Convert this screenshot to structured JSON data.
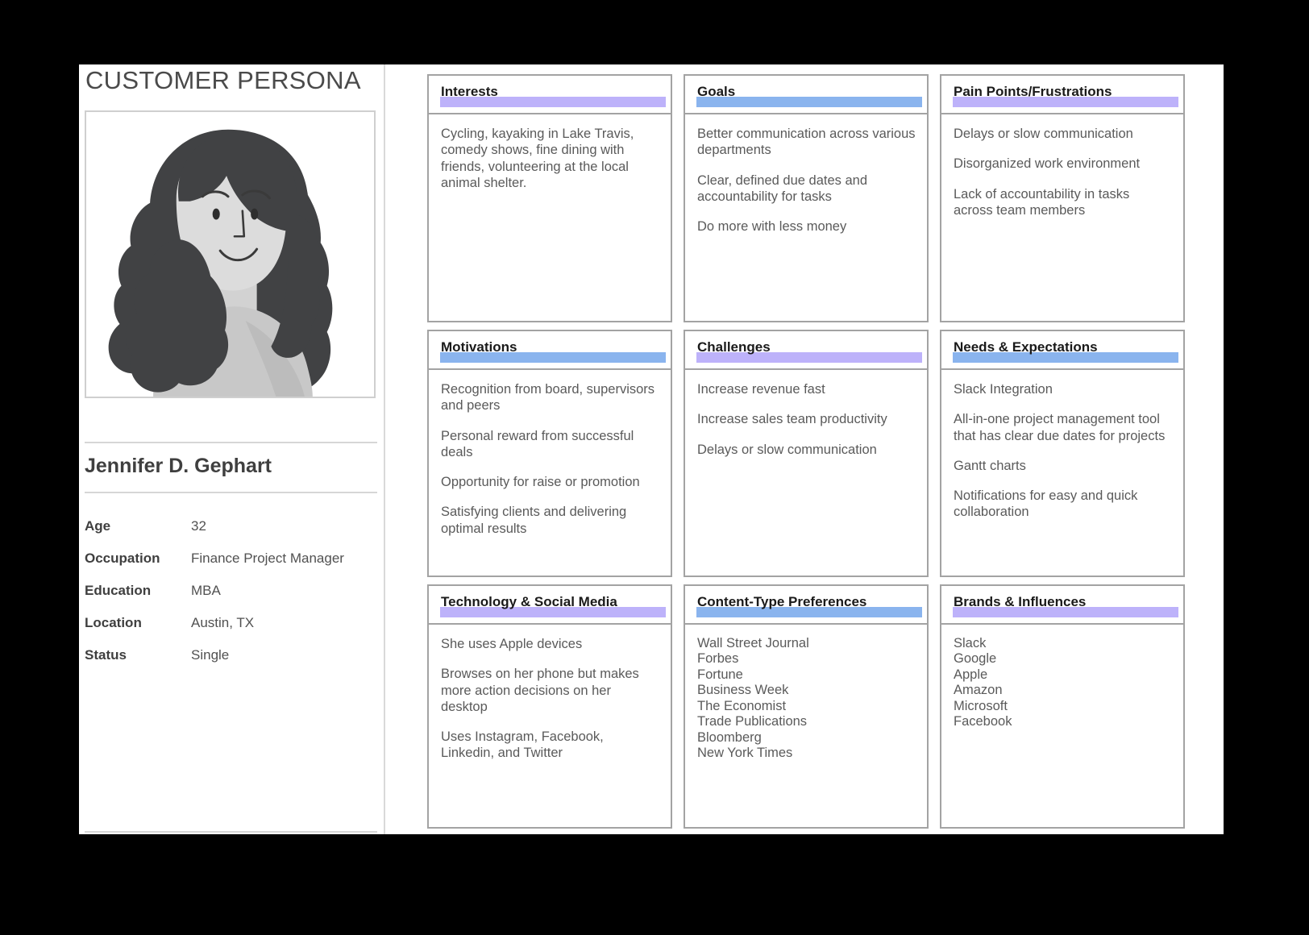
{
  "left": {
    "title": "CUSTOMER PERSONA",
    "avatar_alt": "female-persona-illustration",
    "name": "Jennifer D. Gephart",
    "attributes": [
      {
        "label": "Age",
        "value": "32"
      },
      {
        "label": "Occupation",
        "value": "Finance Project Manager"
      },
      {
        "label": "Education",
        "value": "MBA"
      },
      {
        "label": "Location",
        "value": "Austin, TX"
      },
      {
        "label": "Status",
        "value": "Single"
      }
    ]
  },
  "colors": {
    "purple_bar": "#bdb2fa",
    "blue_bar": "#8ab4ee",
    "card_border": "#a3a3a3",
    "body_text": "#5a5a5a",
    "title_text": "#1a1a1a"
  },
  "cards": [
    {
      "id": "interests",
      "title": "Interests",
      "bar": "purple",
      "layout": "paragraphs",
      "items": [
        "Cycling, kayaking in Lake Travis, comedy shows, fine dining with friends, volunteering at the local animal shelter."
      ]
    },
    {
      "id": "goals",
      "title": "Goals",
      "bar": "blue",
      "layout": "paragraphs",
      "items": [
        "Better communication across various departments",
        "Clear, defined due dates and accountability for tasks",
        "Do more with less money"
      ]
    },
    {
      "id": "pain-points",
      "title": "Pain Points/Frustrations",
      "bar": "purple",
      "layout": "paragraphs",
      "items": [
        "Delays or slow communication",
        "Disorganized work environment",
        "Lack of accountability in tasks across team members"
      ]
    },
    {
      "id": "motivations",
      "title": "Motivations",
      "bar": "blue",
      "layout": "paragraphs",
      "items": [
        "Recognition from board, supervisors and peers",
        "Personal reward from successful deals",
        "Opportunity for raise or promotion",
        "Satisfying clients and delivering optimal results"
      ]
    },
    {
      "id": "challenges",
      "title": "Challenges",
      "bar": "purple",
      "layout": "paragraphs",
      "items": [
        "Increase revenue fast",
        "Increase sales team productivity",
        "Delays or slow communication"
      ]
    },
    {
      "id": "needs-expectations",
      "title": "Needs & Expectations",
      "bar": "blue",
      "layout": "paragraphs",
      "items": [
        "Slack Integration",
        "All-in-one project management tool that has clear due dates for projects",
        "Gantt charts",
        "Notifications for easy and quick collaboration"
      ]
    },
    {
      "id": "technology-social-media",
      "title": "Technology & Social Media",
      "bar": "purple",
      "layout": "paragraphs",
      "items": [
        "She uses Apple devices",
        "Browses on her phone but makes more action decisions on her desktop",
        "Uses Instagram, Facebook, Linkedin, and Twitter"
      ]
    },
    {
      "id": "content-type-preferences",
      "title": "Content-Type Preferences",
      "bar": "blue",
      "layout": "list",
      "items": [
        "Wall Street Journal",
        "Forbes",
        "Fortune",
        "Business Week",
        "The Economist",
        "Trade Publications",
        "Bloomberg",
        "New York Times"
      ]
    },
    {
      "id": "brands-influences",
      "title": "Brands & Influences",
      "bar": "purple",
      "layout": "list",
      "items": [
        "Slack",
        "Google",
        "Apple",
        "Amazon",
        "Microsoft",
        "Facebook"
      ]
    }
  ]
}
